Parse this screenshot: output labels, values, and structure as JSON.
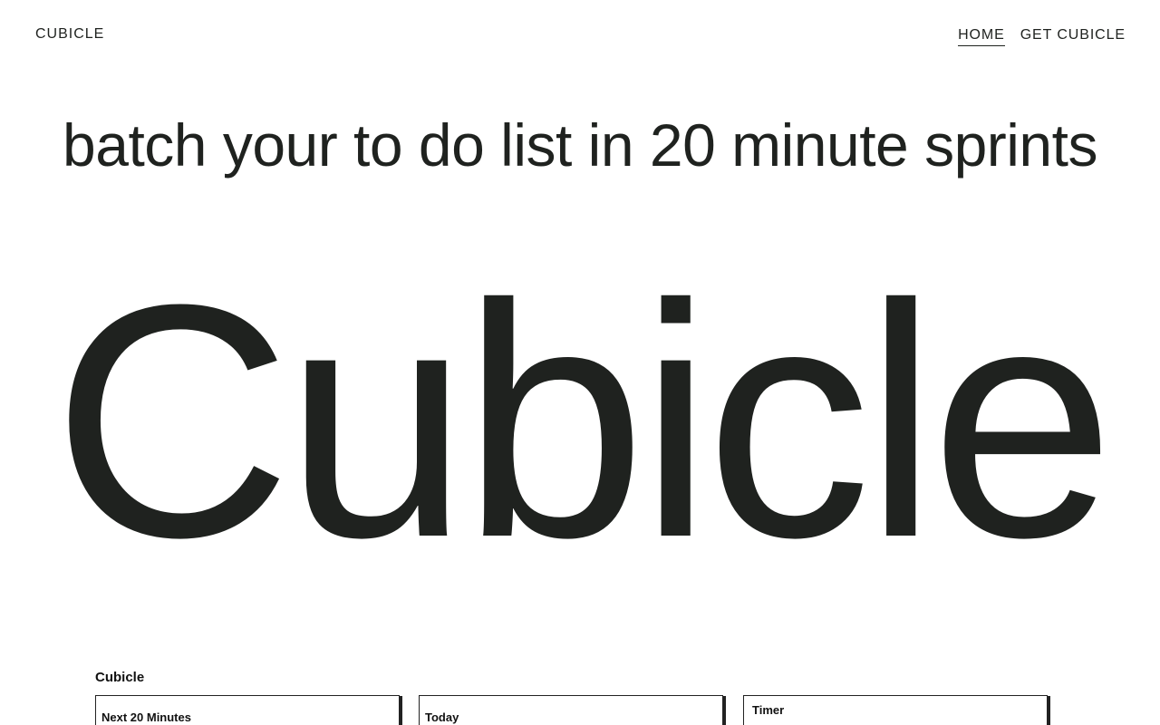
{
  "header": {
    "logo": "CUBICLE",
    "nav": [
      {
        "label": "HOME",
        "active": true
      },
      {
        "label": "GET CUBICLE",
        "active": false
      }
    ]
  },
  "hero": {
    "tagline": "batch your to do list in 20 minute sprints",
    "wordmark": "Cubicle"
  },
  "preview": {
    "title": "Cubicle",
    "panels": [
      {
        "label": "Next 20 Minutes"
      },
      {
        "label": "Today"
      },
      {
        "label": "Timer"
      }
    ]
  },
  "colors": {
    "text": "#1f221f",
    "background": "#ffffff"
  }
}
